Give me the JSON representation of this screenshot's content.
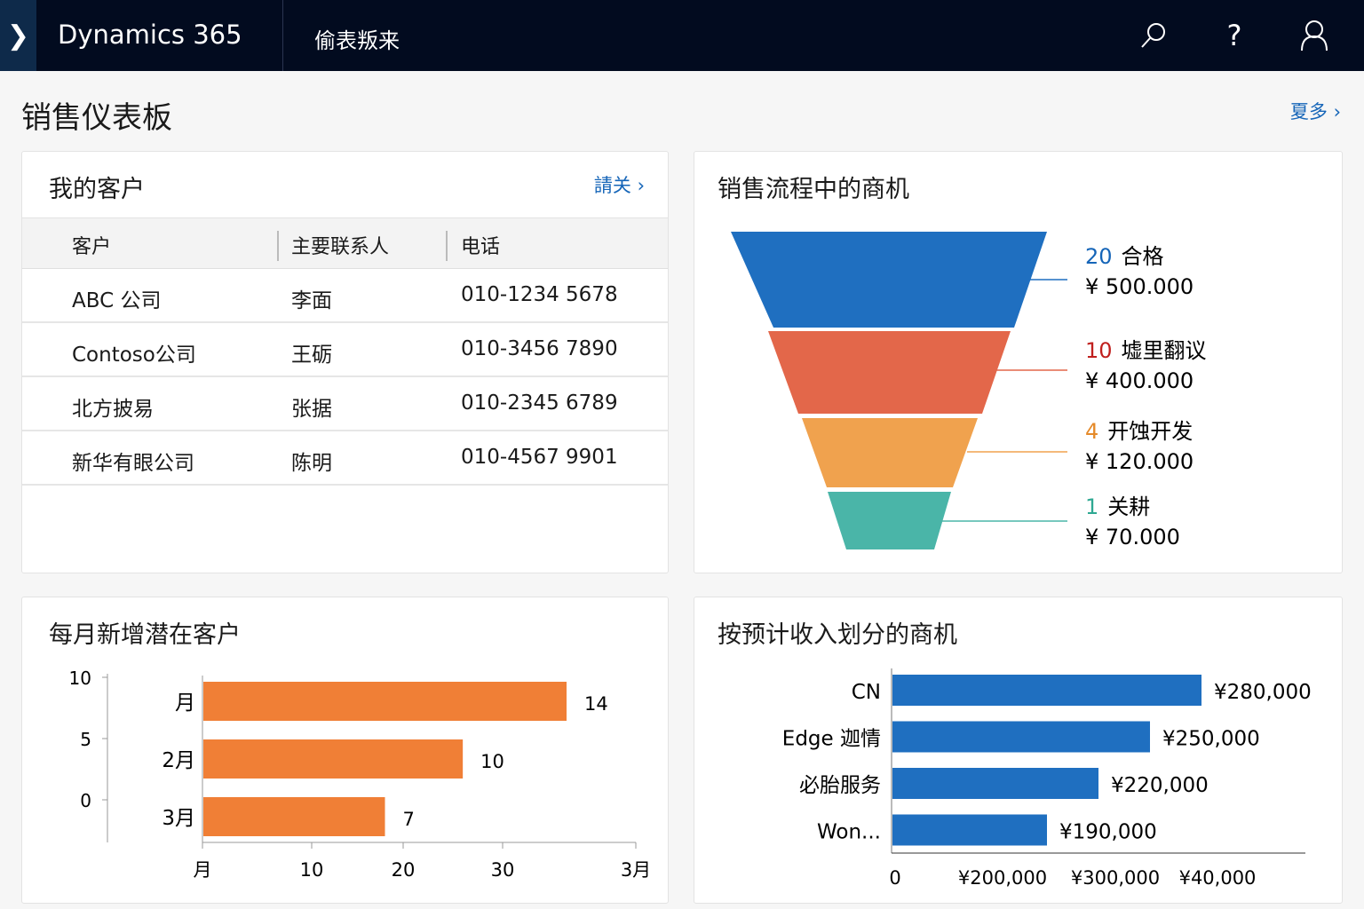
{
  "nav": {
    "brand": "Dynamics 365",
    "module": "偷表叛来",
    "launcher_icon": "chevron-logo-icon",
    "icons": [
      "search-icon",
      "help-icon",
      "user-icon"
    ]
  },
  "page": {
    "title": "销售仪表板",
    "more_link": "夏多 ›"
  },
  "customers": {
    "title": "我的客户",
    "link": "請关 ›",
    "columns": [
      "客户",
      "主要联系人",
      "电话"
    ],
    "rows": [
      [
        "ABC 公司",
        "李面",
        "010-1234 5678"
      ],
      [
        "Contoso公司",
        "王砺",
        "010-3456 7890"
      ],
      [
        "北方披易",
        "张据",
        "010-2345 6789"
      ],
      [
        "新华有眼公司",
        "陈明",
        "010-4567 9901"
      ]
    ]
  },
  "funnel": {
    "title": "销售流程中的商机",
    "colors": [
      "#1f6fc0",
      "#e3674a",
      "#f0a24e",
      "#4ab5a8"
    ],
    "stages": [
      {
        "count": "20",
        "name": "合格",
        "amount": "¥ 500.000"
      },
      {
        "count": "10",
        "name": "墟里翻议",
        "amount": "¥ 400.000"
      },
      {
        "count": "4",
        "name": "开蚀开发",
        "amount": "¥ 120.000"
      },
      {
        "count": "1",
        "name": "关耕",
        "amount": "¥ 70.000"
      }
    ],
    "count_colors": [
      "#1565b8",
      "#c0201e",
      "#e58a2a",
      "#2ea892"
    ]
  },
  "chart_data": [
    {
      "type": "bar",
      "title": "每月新增潜在客户",
      "categories": [
        "月",
        "2月",
        "3月"
      ],
      "values": [
        14,
        10,
        7
      ],
      "color": "#f07f36",
      "y_ticks": [
        "10",
        "5",
        "0"
      ],
      "x_ticks": [
        "月",
        "10",
        "20",
        "30",
        "3月"
      ]
    },
    {
      "type": "bar",
      "title": "按预计收入划分的商机",
      "categories": [
        "CN",
        "Edge 迦情",
        "必胎服务",
        "Won..."
      ],
      "values": [
        280000,
        250000,
        220000,
        190000
      ],
      "value_labels": [
        "¥280,000",
        "¥250,000",
        "¥220,000",
        "¥190,000"
      ],
      "color": "#1f6fc0",
      "x_ticks": [
        "0",
        "¥200,000",
        "¥300,000",
        "¥40,000"
      ]
    }
  ]
}
